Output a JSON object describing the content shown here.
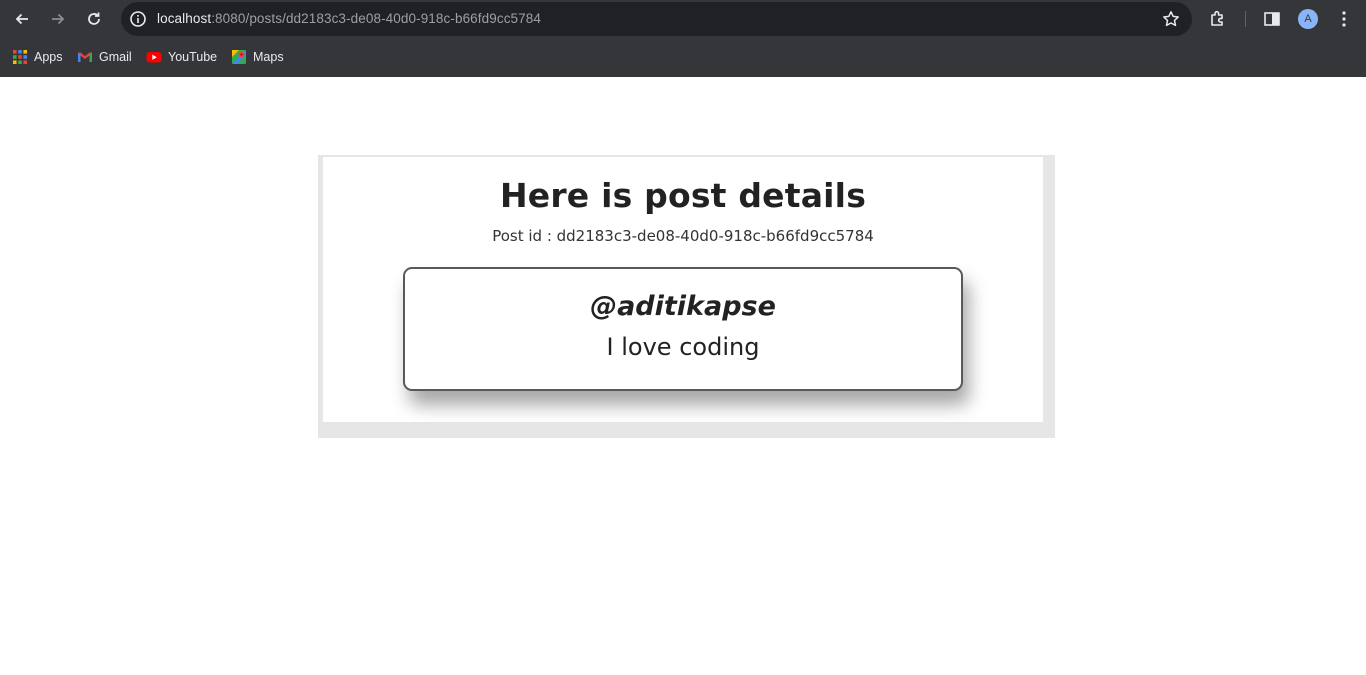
{
  "browser": {
    "url_host": "localhost",
    "url_path": ":8080/posts/dd2183c3-de08-40d0-918c-b66fd9cc5784",
    "profile_initial": "A",
    "icons": [
      "back-arrow-icon",
      "forward-arrow-icon",
      "reload-icon",
      "info-icon",
      "star-icon",
      "extensions-icon",
      "side-panel-icon",
      "more-menu-icon"
    ],
    "bookmarks": [
      {
        "label": "Apps",
        "icon": "apps-grid-icon"
      },
      {
        "label": "Gmail",
        "icon": "gmail-icon"
      },
      {
        "label": "YouTube",
        "icon": "youtube-icon"
      },
      {
        "label": "Maps",
        "icon": "maps-icon"
      }
    ]
  },
  "page": {
    "title": "Here is post details",
    "post_id_text": "Post id : dd2183c3-de08-40d0-918c-b66fd9cc5784",
    "post": {
      "username": "@aditikapse",
      "content": "I love coding"
    }
  },
  "colors": {
    "chrome": "#35363a",
    "omnibox": "#202124",
    "card_shadow": "#e6e6e6",
    "post_border": "#595959"
  }
}
